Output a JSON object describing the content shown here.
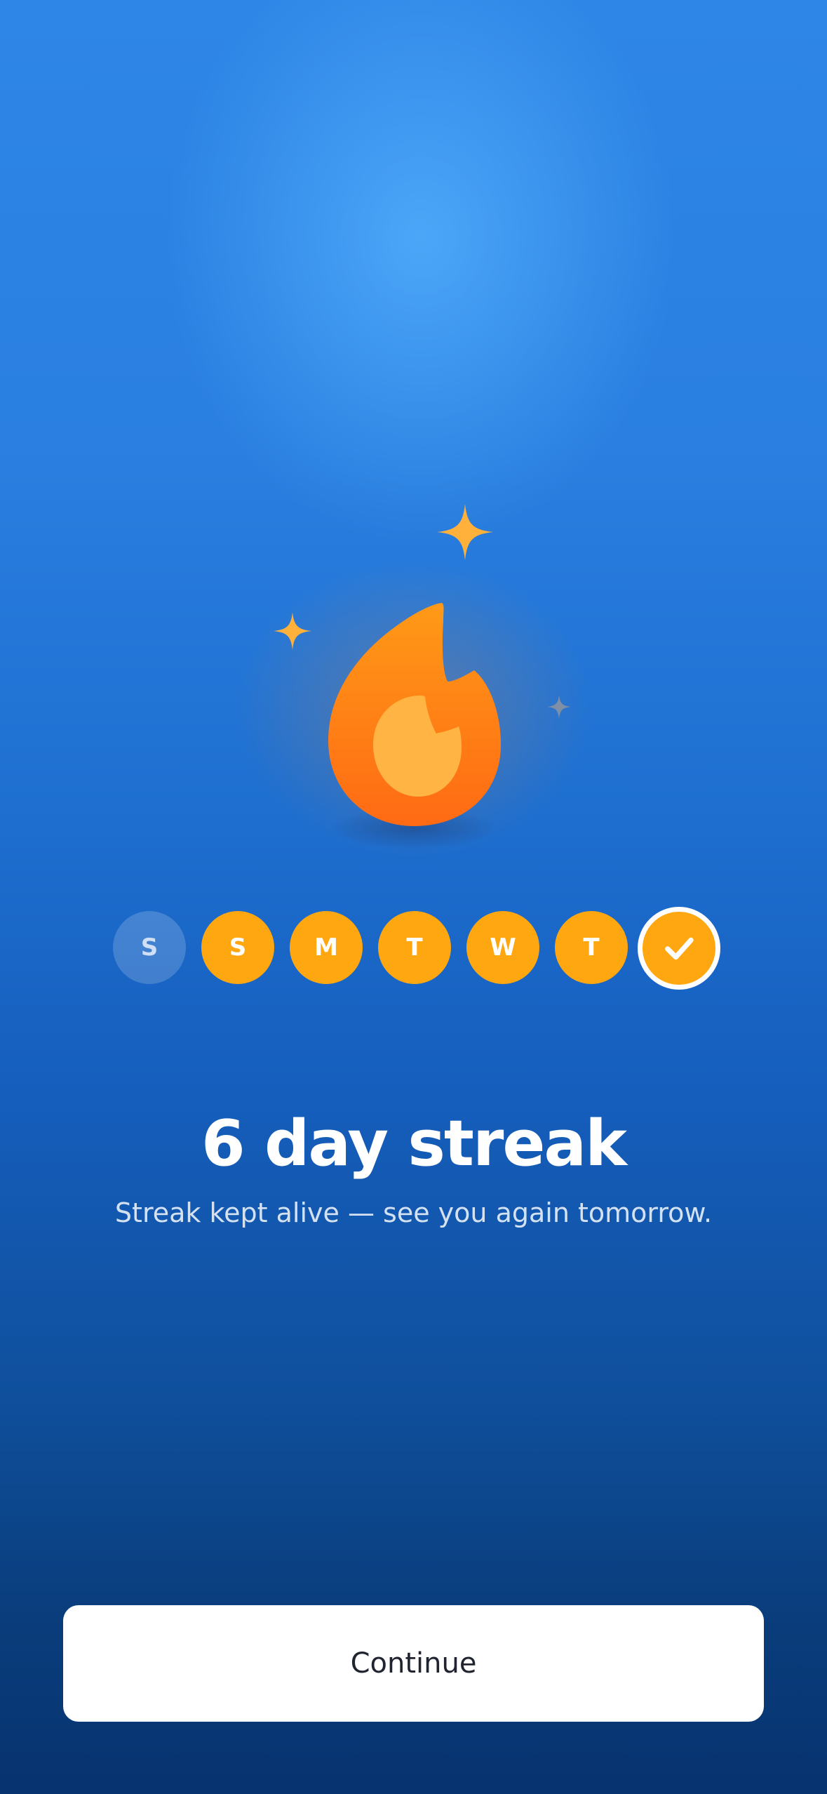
{
  "days": [
    {
      "label": "S",
      "state": "missed"
    },
    {
      "label": "S",
      "state": "done"
    },
    {
      "label": "M",
      "state": "done"
    },
    {
      "label": "T",
      "state": "done"
    },
    {
      "label": "W",
      "state": "done"
    },
    {
      "label": "T",
      "state": "done"
    },
    {
      "label": "",
      "state": "today",
      "icon": "checkmark-icon"
    }
  ],
  "streak": {
    "title": "6 day streak",
    "subtitle": "Streak kept alive — see you again tomorrow."
  },
  "actions": {
    "continue_label": "Continue"
  },
  "colors": {
    "accent": "#ffa711",
    "flame_outer": "#ff7a12",
    "flame_inner": "#ffb443",
    "background_top": "#2e86e6",
    "background_bottom": "#073370"
  },
  "icons": {
    "hero": "flame-icon",
    "sparkles": [
      "sparkle-icon",
      "sparkle-icon",
      "sparkle-icon"
    ]
  }
}
